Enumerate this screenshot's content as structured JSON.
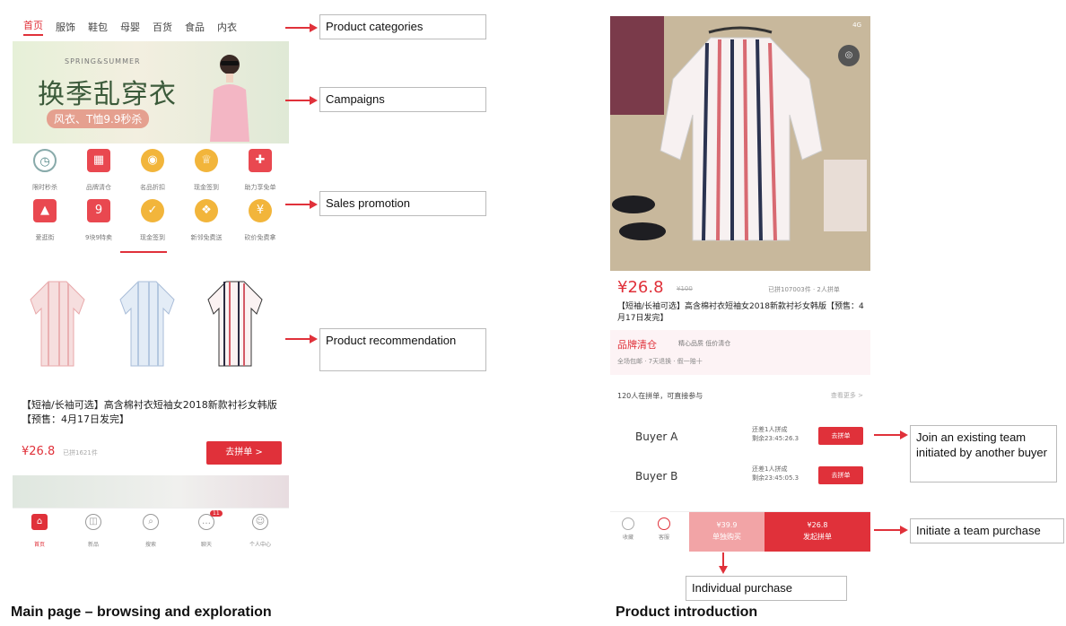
{
  "left_panel": {
    "categories": [
      "首页",
      "服饰",
      "鞋包",
      "母婴",
      "百货",
      "食品",
      "内衣"
    ],
    "banner": {
      "season_text": "SPRING&SUMMER",
      "headline": "换季乱穿衣",
      "tag": "风衣、T恤9.9秒杀"
    },
    "promo_items": [
      {
        "icon": "clock-icon",
        "label": "限时秒杀"
      },
      {
        "icon": "brand-sale-icon",
        "label": "品牌清仓"
      },
      {
        "icon": "coin-icon",
        "label": "名品折扣"
      },
      {
        "icon": "trophy-icon",
        "label": "现金签到"
      },
      {
        "icon": "gift-icon",
        "label": "助力享免单"
      },
      {
        "icon": "dress-icon",
        "label": "爱逛街"
      },
      {
        "icon": "nine-nine-icon",
        "label": "9块9特卖"
      },
      {
        "icon": "coin-check-icon",
        "label": "现金签到"
      },
      {
        "icon": "gift-box-icon",
        "label": "新邻免费送"
      },
      {
        "icon": "coupon-icon",
        "label": "砍价免费拿"
      }
    ],
    "product": {
      "title": "【短袖/长袖可选】高含棉衬衣短袖女2018新款衬衫女韩版【预售：4月17日发完】",
      "price": "¥26.8",
      "sold": "已拼1621件",
      "button": "去拼单 >"
    },
    "tabbar": [
      {
        "icon": "home-icon",
        "label": "首页",
        "active": true
      },
      {
        "icon": "new-icon",
        "label": "新品",
        "active": false
      },
      {
        "icon": "search-icon",
        "label": "搜索",
        "active": false
      },
      {
        "icon": "chat-icon",
        "label": "聊天",
        "active": false,
        "badge": "11"
      },
      {
        "icon": "profile-icon",
        "label": "个人中心",
        "active": false
      }
    ]
  },
  "right_panel": {
    "status": "4G",
    "price": "¥26.8",
    "old_price": "¥100",
    "sold": "已拼107003件 · 2人拼单",
    "title": "【短袖/长袖可选】高含棉衬衣短袖女2018新款衬衫女韩版【预售：4月17日发完】",
    "brand": {
      "name": "品牌清仓",
      "sub": "精心品质 低价清仓",
      "services": "全场包邮 · 7天退换 · 假一赔十"
    },
    "groups_head": "120人在拼单，可直接参与",
    "groups_more": "查看更多 >",
    "buyers": [
      {
        "name": "Buyer A",
        "info_line1": "还差1人拼成",
        "info_line2": "剩余23:45:26.3",
        "button": "去拼单"
      },
      {
        "name": "Buyer B",
        "info_line1": "还差1人拼成",
        "info_line2": "剩余23:45:05.3",
        "button": "去拼单"
      }
    ],
    "bottom": {
      "fav": "收藏",
      "service": "客服",
      "individual_price": "¥39.9",
      "individual_label": "单独购买",
      "team_price": "¥26.8",
      "team_label": "发起拼单"
    }
  },
  "annotations": {
    "product_categories": "Product categories",
    "campaigns": "Campaigns",
    "sales_promotion": "Sales promotion",
    "product_recommendation": "Product recommendation",
    "join_team": "Join an existing team initiated by another buyer",
    "initiate_team": "Initiate a team purchase",
    "individual_purchase": "Individual purchase"
  },
  "captions": {
    "left": "Main page – browsing and exploration",
    "right": "Product introduction"
  }
}
